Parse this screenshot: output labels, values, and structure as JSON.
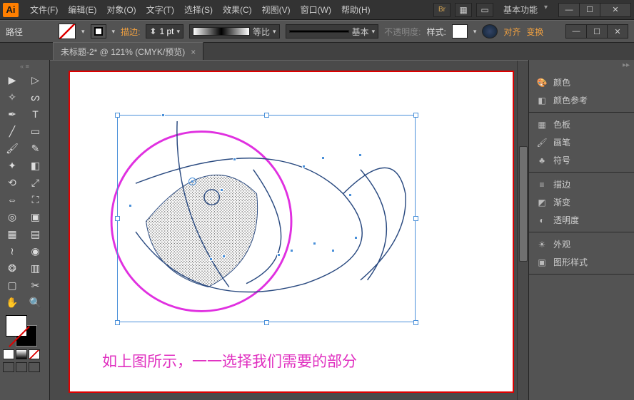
{
  "app": {
    "logo": "Ai"
  },
  "menu": [
    "文件(F)",
    "编辑(E)",
    "对象(O)",
    "文字(T)",
    "选择(S)",
    "效果(C)",
    "视图(V)",
    "窗口(W)",
    "帮助(H)"
  ],
  "title_extras": {
    "workspace": "基本功能"
  },
  "win": {
    "min": "—",
    "max": "☐",
    "close": "✕",
    "sub_min": "—",
    "sub_max": "☐",
    "sub_close": "✕"
  },
  "control": {
    "context": "路径",
    "stroke_label": "描边:",
    "stroke_pt": "1 pt",
    "profile": "等比",
    "brush": "基本",
    "opacity": "不透明度:",
    "style_label": "样式:",
    "align_link": "对齐",
    "transform_link": "变换"
  },
  "tab": {
    "name": "未标题-2* @ 121% (CMYK/预览)",
    "close": "×"
  },
  "panels": {
    "color": "颜色",
    "color_guide": "颜色参考",
    "swatches": "色板",
    "brushes": "画笔",
    "symbols": "符号",
    "stroke": "描边",
    "gradient": "渐变",
    "transparency": "透明度",
    "appearance": "外观",
    "graphic_styles": "图形样式"
  },
  "caption": "如上图所示，一一选择我们需要的部分",
  "colors": {
    "accent": "#4a90d9",
    "magenta": "#e030c0",
    "artboard_border": "#d00"
  }
}
